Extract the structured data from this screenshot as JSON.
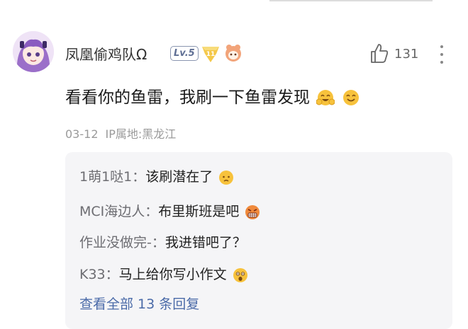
{
  "comment": {
    "username": "凤凰偷鸡队Ω",
    "level_badge": "Lv.5",
    "medal_badge": "11",
    "like_count": "131",
    "text": "看看你的鱼雷，我刷一下鱼雷发现",
    "date": "03-12",
    "ip_location": "IP属地:黑龙江"
  },
  "replies": [
    {
      "author": "1萌1哒1",
      "separator": "：",
      "text": "该刷潜在了",
      "emoji": "worried-face-icon"
    },
    {
      "author": "MCI海边人",
      "separator": "：",
      "text": "布里斯班是吧",
      "emoji": "grimacing-angry-face-icon"
    },
    {
      "author": "作业没做完-",
      "separator": "：",
      "text": "我进错吧了？",
      "emoji": ""
    },
    {
      "author": "K33",
      "separator": "：",
      "text": "马上给你写小作文",
      "emoji": "astonished-face-icon"
    }
  ],
  "view_all": "查看全部 13 条回复",
  "colors": {
    "link": "#4a6aa8",
    "meta": "#9a9a9a",
    "reply_bg": "#f5f5f7",
    "emoji": "#f7c23c"
  }
}
